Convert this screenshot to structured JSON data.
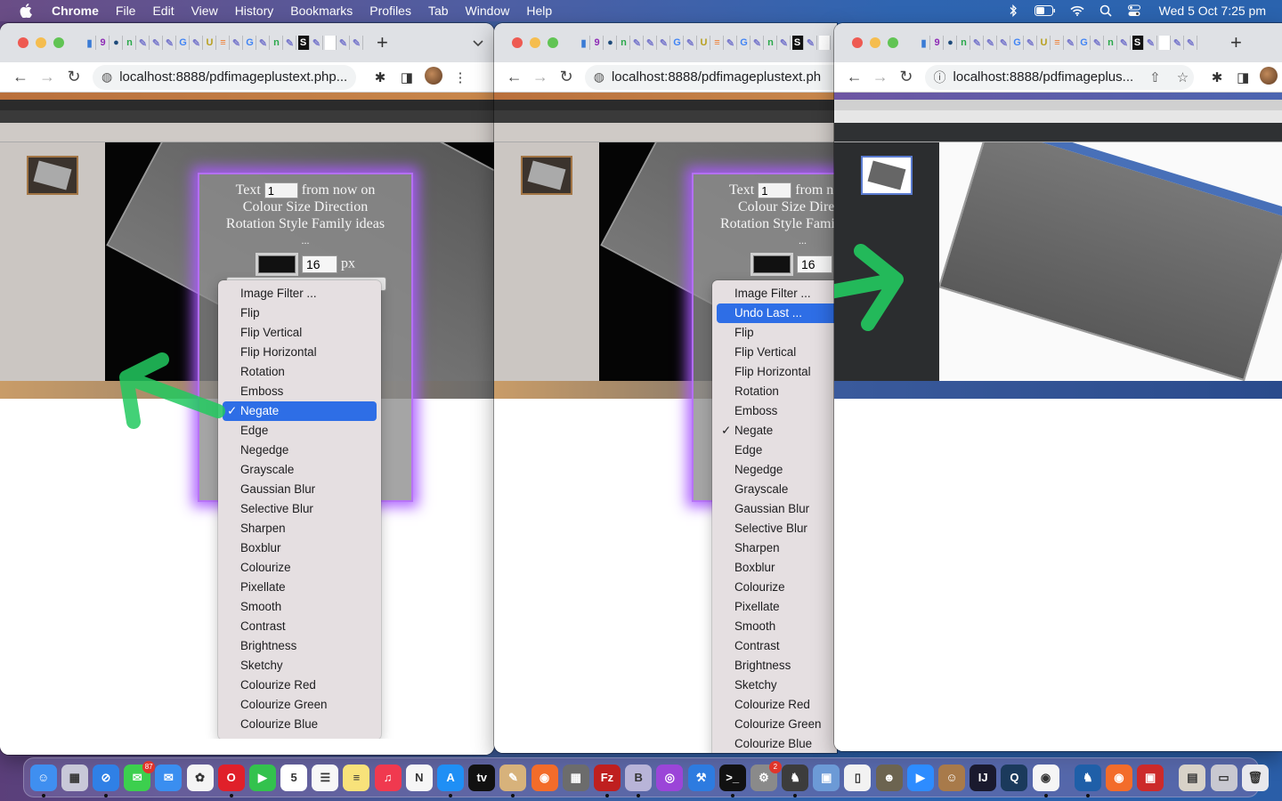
{
  "menubar": {
    "app_name": "Chrome",
    "items": [
      "File",
      "Edit",
      "View",
      "History",
      "Bookmarks",
      "Profiles",
      "Tab",
      "Window",
      "Help"
    ],
    "status_icons": [
      "bluetooth-icon",
      "battery-icon",
      "wifi-icon",
      "spotlight-search-icon",
      "control-center-icon"
    ],
    "clock": "Wed 5 Oct  7:25 pm"
  },
  "windows": [
    {
      "url_host": "localhost",
      "url_rest": ":8888/pdfimageplustext.php...",
      "site_icon": "globe-icon",
      "toolbar_icons": [
        "extensions-icon",
        "side-panel-icon",
        "profile-avatar",
        "kebab-menu-icon"
      ],
      "panel": {
        "line1_before": "Text",
        "text_value": "1",
        "line1_after": "from now on",
        "line2": "Colour Size Direction",
        "line3": "Rotation Style Family ideas",
        "line4": "...",
        "size_value": "16",
        "size_unit": "px",
        "swatch_color": "#111111"
      },
      "dropdown": {
        "options": [
          "Image Filter ...",
          "Flip",
          "Flip Vertical",
          "Flip Horizontal",
          "Rotation",
          "Emboss",
          "Negate",
          "Edge",
          "Negedge",
          "Grayscale",
          "Gaussian Blur",
          "Selective Blur",
          "Sharpen",
          "Boxblur",
          "Colourize",
          "Pixellate",
          "Smooth",
          "Contrast",
          "Brightness",
          "Sketchy",
          "Colourize Red",
          "Colourize Green",
          "Colourize Blue"
        ],
        "checked": "Negate",
        "highlighted": "Negate"
      }
    },
    {
      "url_host": "localhost",
      "url_rest": ":8888/pdfimageplustext.ph",
      "site_icon": "globe-icon",
      "panel": {
        "line1_before": "Text",
        "text_value": "1",
        "line1_after": "from n",
        "line2": "Colour Size Dire",
        "line3": "Rotation Style Fami",
        "line4": "...",
        "size_value": "16"
      },
      "dropdown": {
        "options": [
          "Image Filter ...",
          "Undo Last ...",
          "Flip",
          "Flip Vertical",
          "Flip Horizontal",
          "Rotation",
          "Emboss",
          "Negate",
          "Edge",
          "Negedge",
          "Grayscale",
          "Gaussian Blur",
          "Selective Blur",
          "Sharpen",
          "Boxblur",
          "Colourize",
          "Pixellate",
          "Smooth",
          "Contrast",
          "Brightness",
          "Sketchy",
          "Colourize Red",
          "Colourize Green",
          "Colourize Blue"
        ],
        "checked": "Negate",
        "highlighted": "Undo Last ..."
      }
    },
    {
      "url_host": "localhost",
      "url_rest": ":8888/pdfimageplus...",
      "site_icon": "info-icon",
      "toolbar_icons": [
        "share-icon",
        "bookmark-star-icon",
        "extensions-icon",
        "side-panel-icon"
      ]
    }
  ],
  "tab_favicons": [
    "db",
    "9",
    "●",
    "n",
    "✎",
    "✎",
    "✎",
    "G",
    "✎",
    "U",
    "≡",
    "✎",
    "G",
    "✎",
    "n",
    "✎",
    "S",
    "✎",
    "",
    "✎",
    "✎"
  ],
  "dock": {
    "apps": [
      {
        "name": "Finder",
        "color": "#3f8ff0",
        "glyph": "☺",
        "running": true
      },
      {
        "name": "Launchpad",
        "color": "#c8c8d8",
        "glyph": "▦",
        "running": false
      },
      {
        "name": "Safari",
        "color": "#2f80e6",
        "glyph": "⊘",
        "running": true
      },
      {
        "name": "Messages",
        "color": "#3ccf4e",
        "glyph": "✉",
        "running": false,
        "badge": "87"
      },
      {
        "name": "Mail",
        "color": "#3a8ef0",
        "glyph": "✉",
        "running": false
      },
      {
        "name": "Photos",
        "color": "#f4f4f4",
        "glyph": "✿",
        "running": false
      },
      {
        "name": "Opera",
        "color": "#e0202a",
        "glyph": "O",
        "running": true
      },
      {
        "name": "FaceTime",
        "color": "#33c24d",
        "glyph": "▶",
        "running": false
      },
      {
        "name": "Calendar",
        "color": "#ffffff",
        "glyph": "5",
        "running": false
      },
      {
        "name": "Reminders",
        "color": "#f7f7f7",
        "glyph": "☰",
        "running": false
      },
      {
        "name": "Notes",
        "color": "#f8e27a",
        "glyph": "≡",
        "running": false
      },
      {
        "name": "Music",
        "color": "#f0394f",
        "glyph": "♫",
        "running": false
      },
      {
        "name": "News",
        "color": "#f6f6f6",
        "glyph": "N",
        "running": false
      },
      {
        "name": "App Store",
        "color": "#1f8ff5",
        "glyph": "A",
        "running": true
      },
      {
        "name": "Apple TV",
        "color": "#111111",
        "glyph": "tv",
        "running": false
      },
      {
        "name": "Paintbrush",
        "color": "#d7b27b",
        "glyph": "✎",
        "running": true
      },
      {
        "name": "Firefox",
        "color": "#f36c2a",
        "glyph": "◉",
        "running": false
      },
      {
        "name": "Calculator",
        "color": "#6c6c6c",
        "glyph": "▦",
        "running": false
      },
      {
        "name": "FileZilla",
        "color": "#bf1f1f",
        "glyph": "Fz",
        "running": true
      },
      {
        "name": "BBEdit",
        "color": "#b8b4d8",
        "glyph": "B",
        "running": true
      },
      {
        "name": "Podcasts",
        "color": "#9b45d8",
        "glyph": "◎",
        "running": false
      },
      {
        "name": "Xcode",
        "color": "#2d7be0",
        "glyph": "⚒",
        "running": false
      },
      {
        "name": "Terminal",
        "color": "#111111",
        "glyph": ">_",
        "running": true
      },
      {
        "name": "System Preferences",
        "color": "#8a8a8a",
        "glyph": "⚙",
        "running": false,
        "badge": "2"
      },
      {
        "name": "MAMP",
        "color": "#3c3c3c",
        "glyph": "♞",
        "running": true
      },
      {
        "name": "Preview",
        "color": "#6c9ad6",
        "glyph": "▣",
        "running": false
      },
      {
        "name": "LibreOffice",
        "color": "#f2f2f2",
        "glyph": "▯",
        "running": false
      },
      {
        "name": "GIMP",
        "color": "#6c6450",
        "glyph": "☻",
        "running": false
      },
      {
        "name": "Zoom",
        "color": "#2d8cff",
        "glyph": "▶",
        "running": false
      },
      {
        "name": "Contacts",
        "color": "#a87a4a",
        "glyph": "☺",
        "running": false
      },
      {
        "name": "IntelliJ IDEA",
        "color": "#1a1a2e",
        "glyph": "IJ",
        "running": false
      },
      {
        "name": "QuickTime Player",
        "color": "#1b3a5c",
        "glyph": "Q",
        "running": false
      },
      {
        "name": "Google Chrome",
        "color": "#f5f5f5",
        "glyph": "◉",
        "running": true
      }
    ],
    "apps_right": [
      {
        "name": "MAMP PRO",
        "color": "#1f5fa8",
        "glyph": "♞",
        "running": true
      },
      {
        "name": "Firefox Developer Edition",
        "color": "#f36c2a",
        "glyph": "◉",
        "running": false
      },
      {
        "name": "Photo Booth",
        "color": "#cc2a2a",
        "glyph": "▣",
        "running": false
      }
    ],
    "stack_items": [
      {
        "name": "Downloads",
        "color": "#d8d2c8",
        "glyph": "▤"
      },
      {
        "name": "Screenshot Folder",
        "color": "#c8c8d0",
        "glyph": "▭"
      },
      {
        "name": "Trash",
        "color": "#e8e8ec",
        "glyph": "🗑"
      }
    ]
  }
}
